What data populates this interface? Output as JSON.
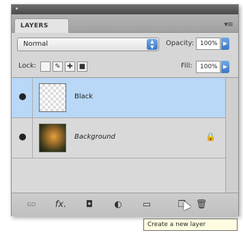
{
  "panel": {
    "tab_label": "LAYERS",
    "menu_icon": "panel-menu-icon",
    "blend_mode": "Normal",
    "opacity_label": "Opacity:",
    "opacity_value": "100%",
    "lock_label": "Lock:",
    "fill_label": "Fill:",
    "fill_value": "100%"
  },
  "layers": [
    {
      "name": "Black",
      "visible": true,
      "selected": true,
      "thumb": "transparent",
      "locked": false
    },
    {
      "name": "Background",
      "visible": true,
      "selected": false,
      "thumb": "photo",
      "locked": true
    }
  ],
  "footer": {
    "icons": [
      "link-layers-icon",
      "fx-icon",
      "layer-mask-icon",
      "adjustment-layer-icon",
      "group-icon",
      "new-layer-icon",
      "trash-icon"
    ],
    "link_label": "GO",
    "fx_label": "fx."
  },
  "tooltip": "Create a new layer",
  "colors": {
    "selection": "#b9d7f6",
    "accent": "#3a77c6"
  }
}
